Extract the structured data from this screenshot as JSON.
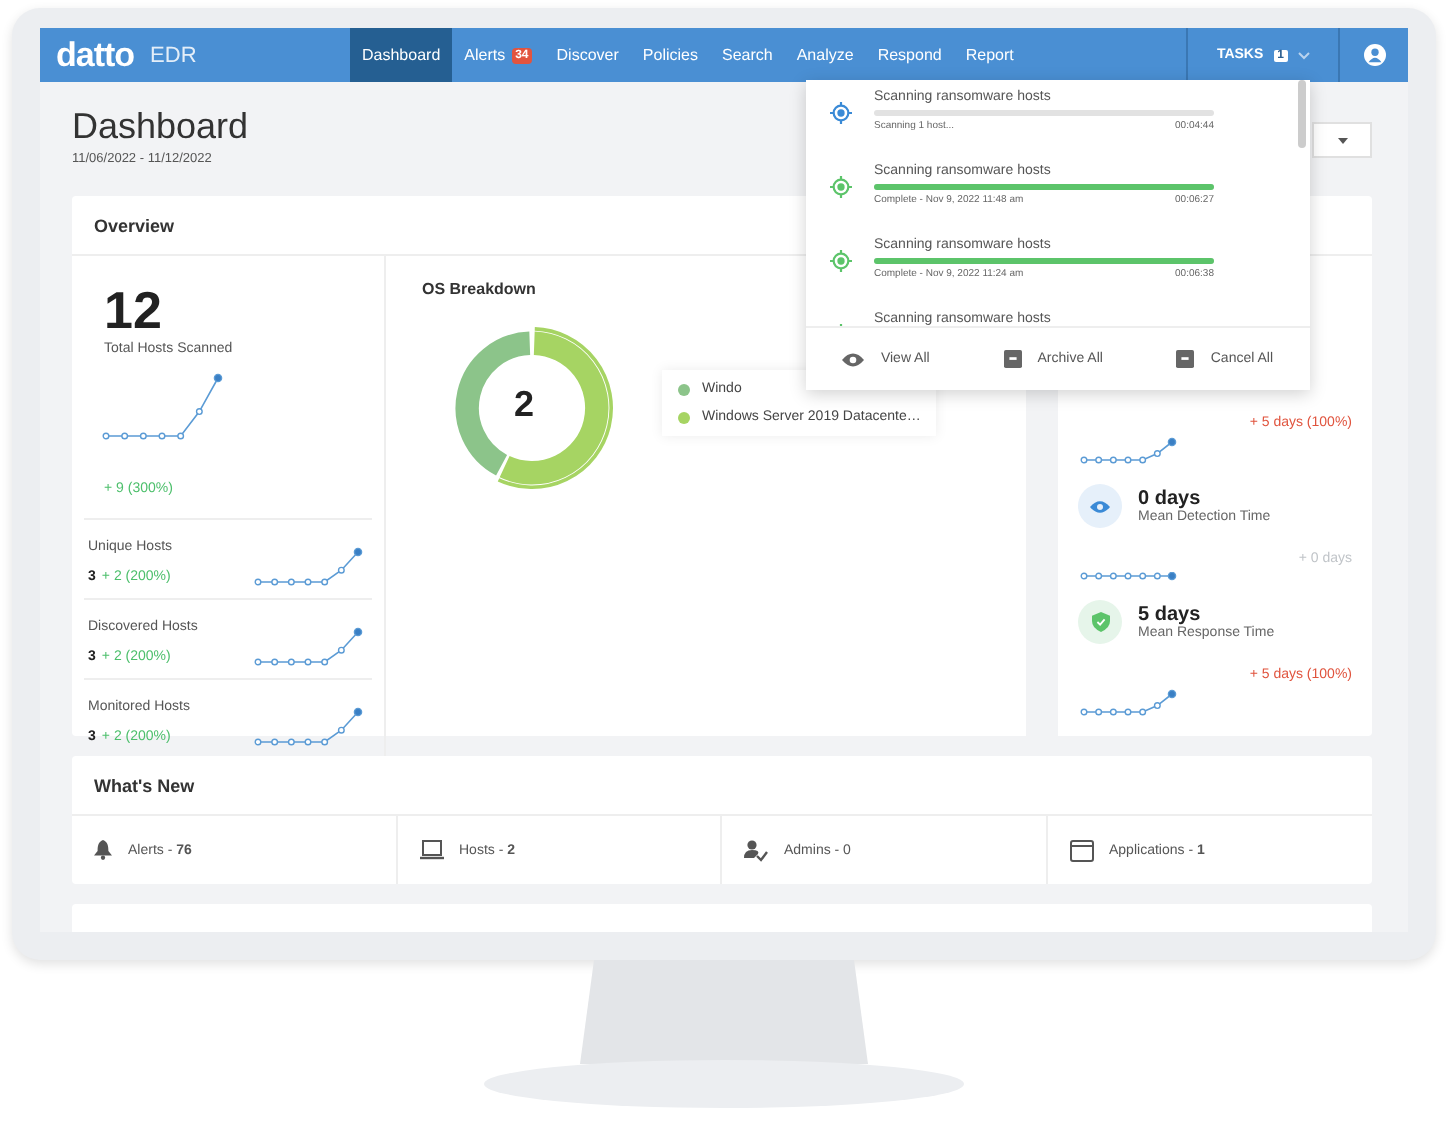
{
  "nav": {
    "logo": "datto",
    "product": "EDR",
    "items": [
      {
        "label": "Dashboard",
        "selected": true
      },
      {
        "label": "Alerts",
        "selected": false,
        "badge": "34"
      },
      {
        "label": "Discover",
        "selected": false
      },
      {
        "label": "Policies",
        "selected": false
      },
      {
        "label": "Search",
        "selected": false
      },
      {
        "label": "Analyze",
        "selected": false
      },
      {
        "label": "Respond",
        "selected": false
      },
      {
        "label": "Report",
        "selected": false
      }
    ],
    "tasks": {
      "label": "TASKS",
      "count": "1"
    }
  },
  "header": {
    "title": "Dashboard",
    "date_range": "11/06/2022 - 11/12/2022"
  },
  "overview": {
    "title": "Overview",
    "total": {
      "value": "12",
      "label": "Total Hosts Scanned",
      "delta": "+ 9 (300%)"
    },
    "stats": [
      {
        "label": "Unique Hosts",
        "value": "3",
        "delta": "+ 2 (200%)"
      },
      {
        "label": "Discovered Hosts",
        "value": "3",
        "delta": "+ 2 (200%)"
      },
      {
        "label": "Monitored Hosts",
        "value": "3",
        "delta": "+ 2 (200%)"
      }
    ],
    "os_breakdown": {
      "title": "OS Breakdown",
      "total": "2",
      "legend": [
        {
          "label": "Windo",
          "color": "#8cc48a"
        },
        {
          "label": "Windows Server 2019 Datacente…",
          "color": "#a6d463"
        }
      ]
    },
    "metrics": [
      {
        "kind": "rising",
        "delta": "+ 5 days (100%)",
        "color": "#e0533d"
      },
      {
        "kind": "detection",
        "value": "0 days",
        "label": "Mean Detection Time",
        "delta": "+ 0 days",
        "color": "#c0c4c8"
      },
      {
        "kind": "response",
        "value": "5 days",
        "label": "Mean Response Time",
        "delta": "+ 5 days (100%)",
        "color": "#e0533d"
      }
    ]
  },
  "tasks_dropdown": {
    "items": [
      {
        "kind": "running",
        "title": "Scanning ransomware hosts",
        "level": 0,
        "status": "Scanning 1 host...",
        "time": "00:04:44"
      },
      {
        "kind": "complete",
        "title": "Scanning ransomware hosts",
        "level": 1,
        "status": "Complete - Nov 9, 2022 11:48 am",
        "time": "00:06:27"
      },
      {
        "kind": "complete",
        "title": "Scanning ransomware hosts",
        "level": 1,
        "status": "Complete - Nov 9, 2022 11:24 am",
        "time": "00:06:38"
      },
      {
        "kind": "complete",
        "title": "Scanning ransomware hosts"
      }
    ],
    "actions": [
      {
        "label": "View All",
        "kind": "view"
      },
      {
        "label": "Archive All",
        "kind": "archive"
      },
      {
        "label": "Cancel All",
        "kind": "cancel"
      }
    ]
  },
  "whats_new": {
    "title": "What's New",
    "items": [
      {
        "kind": "alerts",
        "label": "Alerts - **76**"
      },
      {
        "kind": "hosts",
        "label": "Hosts - **2**"
      },
      {
        "kind": "admins",
        "label": "Admins - 0"
      },
      {
        "kind": "applications",
        "label": "Applications - **1**"
      }
    ]
  }
}
